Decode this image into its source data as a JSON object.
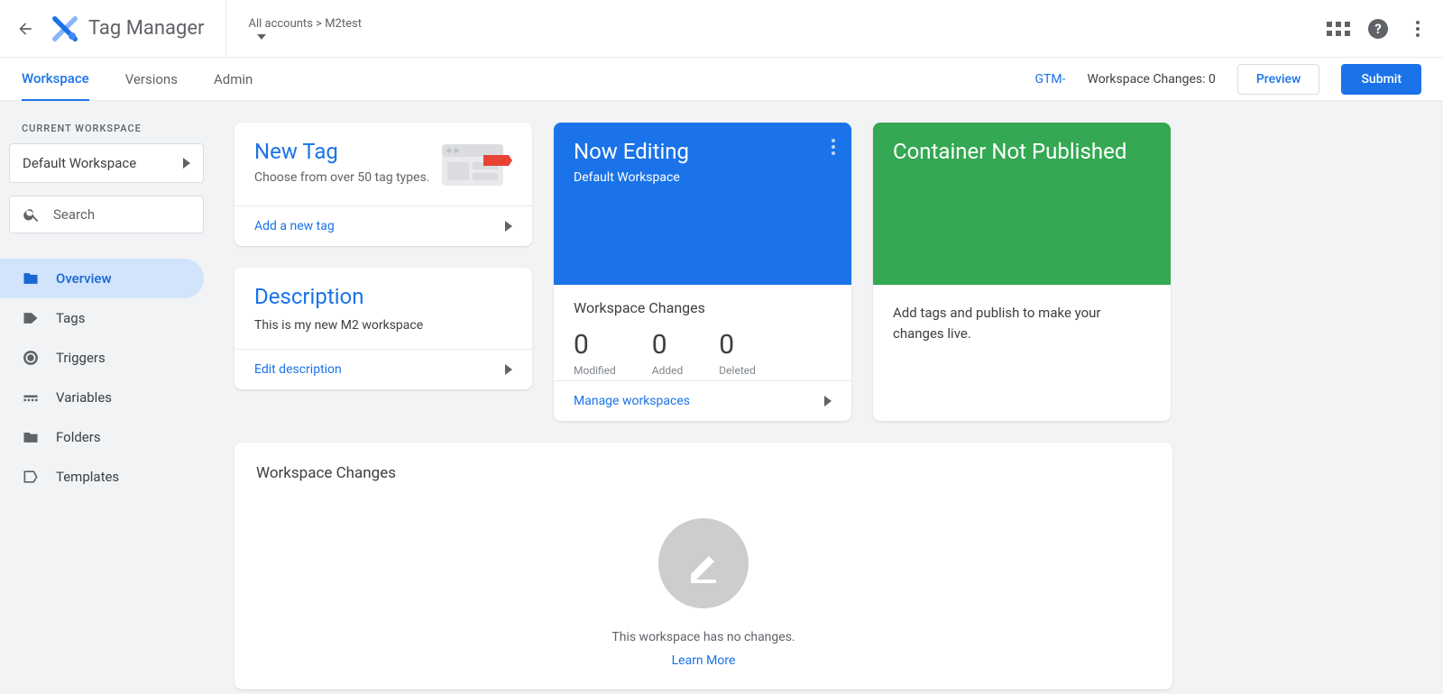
{
  "header": {
    "app": "Tag Manager",
    "breadcrumb_all": "All accounts",
    "breadcrumb_sep": ">",
    "breadcrumb_account": "M2test"
  },
  "nav": {
    "tabs": [
      "Workspace",
      "Versions",
      "Admin"
    ],
    "container_id": "GTM-",
    "changes_label": "Workspace Changes: 0",
    "preview": "Preview",
    "submit": "Submit"
  },
  "sidebar": {
    "section_label": "CURRENT WORKSPACE",
    "workspace": "Default Workspace",
    "search_placeholder": "Search",
    "items": [
      "Overview",
      "Tags",
      "Triggers",
      "Variables",
      "Folders",
      "Templates"
    ]
  },
  "cards": {
    "newtag": {
      "title": "New Tag",
      "sub": "Choose from over 50 tag types.",
      "action": "Add a new tag"
    },
    "desc": {
      "title": "Description",
      "text": "This is my new M2 workspace",
      "action": "Edit description"
    },
    "editing": {
      "title": "Now Editing",
      "sub": "Default Workspace",
      "ws_changes": "Workspace Changes",
      "modified": "0",
      "modified_l": "Modified",
      "added": "0",
      "added_l": "Added",
      "deleted": "0",
      "deleted_l": "Deleted",
      "action": "Manage workspaces"
    },
    "publish": {
      "title": "Container Not Published",
      "body": "Add tags and publish to make your changes live."
    }
  },
  "bottom": {
    "title": "Workspace Changes",
    "empty": "This workspace has no changes.",
    "learn": "Learn More"
  }
}
